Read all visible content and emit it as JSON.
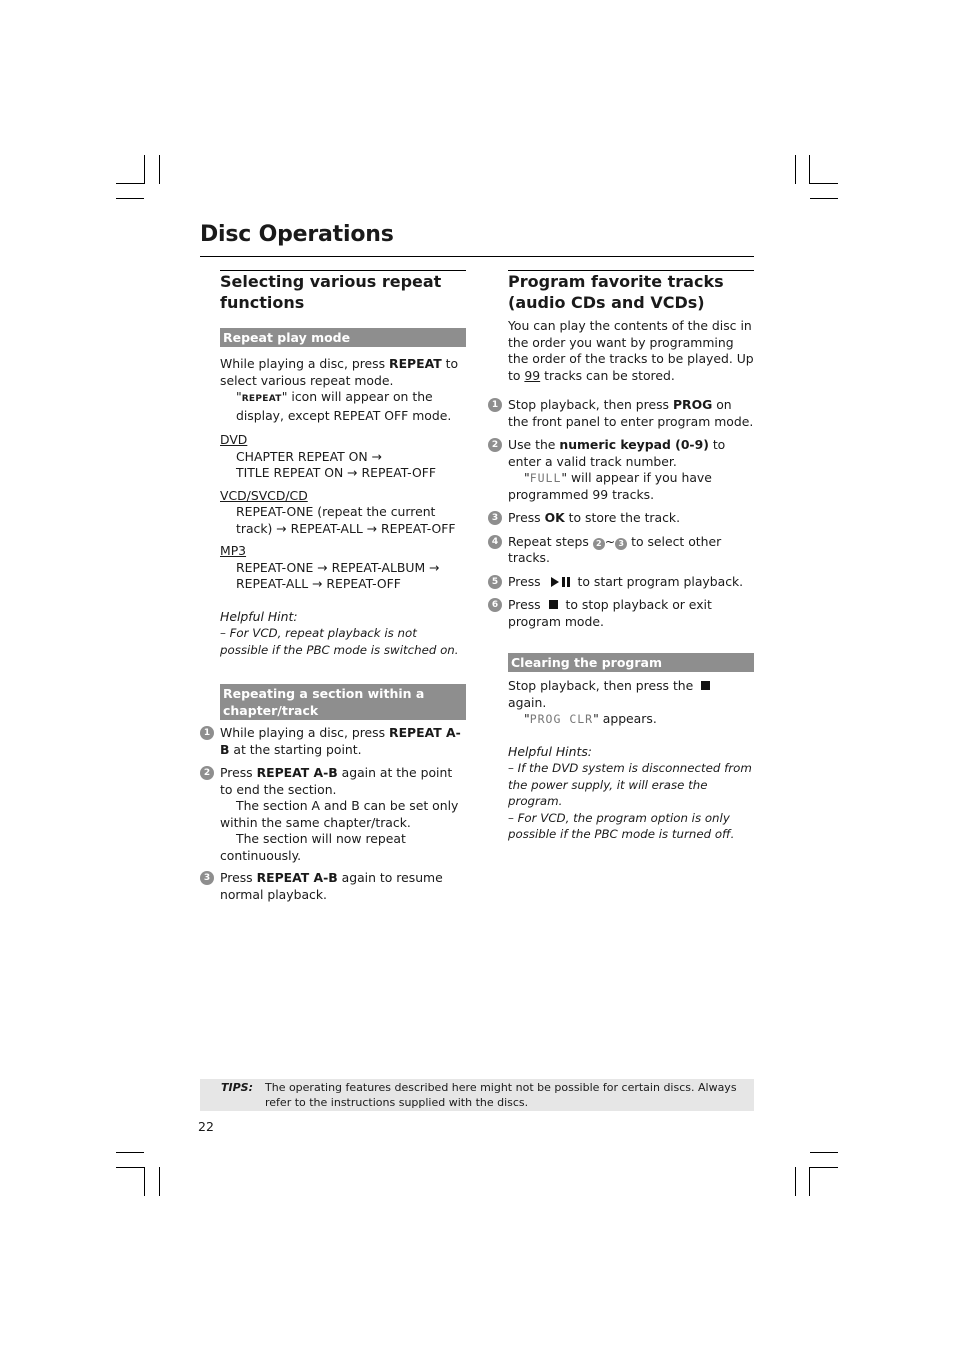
{
  "page": {
    "title": "Disc Operations",
    "page_number": "22"
  },
  "left": {
    "heading": "Selecting various repeat functions",
    "repeat_play_mode": {
      "bar": "Repeat play mode",
      "intro_a": "While playing a disc, press ",
      "intro_key": "REPEAT",
      "intro_b": " to select various repeat mode.",
      "icon_quote_open": "\"",
      "icon_label": "REPEAT",
      "icon_rest": "\" icon will appear on the display, except REPEAT OFF mode.",
      "modes": [
        {
          "label": "DVD",
          "lines": [
            "CHAPTER REPEAT ON →",
            "TITLE REPEAT ON → REPEAT-OFF"
          ]
        },
        {
          "label": "VCD/SVCD/CD",
          "lines": [
            "REPEAT-ONE (repeat the current track) → REPEAT-ALL → REPEAT-OFF"
          ]
        },
        {
          "label": "MP3",
          "lines": [
            "REPEAT-ONE → REPEAT-ALBUM → REPEAT-ALL → REPEAT-OFF"
          ]
        }
      ],
      "hint_title": "Helpful Hint:",
      "hint_text": "–  For VCD, repeat playback is not possible if the PBC mode is switched on."
    },
    "repeat_section": {
      "bar": "Repeating a section within a chapter/track",
      "steps": [
        {
          "num": "1",
          "a": "While playing a disc, press ",
          "key": "REPEAT A-B",
          "b": " at the starting point."
        },
        {
          "num": "2",
          "a": "Press ",
          "key": "REPEAT A-B",
          "b": " again at the point to end the section.",
          "note1": "The section A and B can be set only within the same chapter/track.",
          "note2": "The section will now repeat continuously."
        },
        {
          "num": "3",
          "a": "Press ",
          "key": "REPEAT A-B",
          "b": " again to resume normal playback."
        }
      ]
    }
  },
  "right": {
    "heading": "Program favorite tracks (audio CDs and VCDs)",
    "intro_a": "You can play the contents of the disc in the order you want by programming the order of the tracks to be played. Up to ",
    "intro_num": "99",
    "intro_b": " tracks can be stored.",
    "steps": [
      {
        "num": "1",
        "a": "Stop playback, then press ",
        "key": "PROG",
        "b": " on the front panel to enter program mode."
      },
      {
        "num": "2",
        "a": "Use the ",
        "key": "numeric keypad (0-9)",
        "b": " to enter a valid track number.",
        "lcd": "FULL",
        "note": " will appear if you have programmed 99 tracks."
      },
      {
        "num": "3",
        "a": "Press ",
        "key": "OK",
        "b": " to store the track."
      },
      {
        "num": "4",
        "a": "Repeat steps ",
        "ref1": "2",
        "sep": "~",
        "ref2": "3",
        "b": " to select other tracks."
      },
      {
        "num": "5",
        "a": "Press ",
        "b": " to start program playback."
      },
      {
        "num": "6",
        "a": "Press ",
        "b": " to stop playback or exit program mode."
      }
    ],
    "clearing": {
      "bar": "Clearing the program",
      "a": "Stop playback, then press the ",
      "b": " again.",
      "lcd": "PROG CLR",
      "c": " appears.",
      "hints_title": "Helpful Hints:",
      "hint1": "–  If the DVD system is disconnected from the power supply, it will erase the program.",
      "hint2": "–  For VCD, the program option is only possible if the PBC mode is turned off."
    }
  },
  "tips": {
    "label": "TIPS:",
    "text": "The operating features described here might not be possible for certain discs.  Always refer to the instructions supplied with the discs."
  },
  "icons": {
    "stop": "stop-square-icon",
    "play_pause": "play-pause-icon",
    "step_number": "circled-number-icon"
  }
}
